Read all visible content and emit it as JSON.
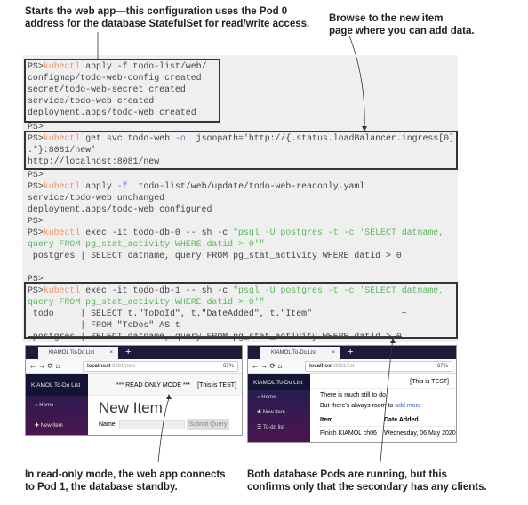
{
  "annotations": {
    "top_left": [
      "Starts the web app—this configuration uses the Pod 0",
      "address for the database StatefulSet for read/write access."
    ],
    "top_right": [
      "Browse to the new item",
      "page where you can add data."
    ],
    "bottom_left": [
      "In read-only mode, the web app connects",
      "to Pod 1, the database standby."
    ],
    "bottom_right": [
      "Both database Pods are running, but this",
      "confirms only that the secondary has any clients."
    ]
  },
  "terminal": {
    "prompt": "PS>",
    "cmd": "kubectl",
    "l1": " apply -f todo-list/web/",
    "l2": "configmap/todo-web-config created",
    "l3": "secret/todo-web-secret created",
    "l4": "service/todo-web created",
    "l5": "deployment.apps/todo-web created",
    "l7a": " get svc todo-web ",
    "l7b": "-o",
    " l7c": " jsonpath='http://{.status.loadBalancer.ingress[0]",
    "l8": ".*}:8081/new'",
    "l9": "http://localhost:8081/new",
    "l11a": " apply ",
    "l11b": "-f",
    " l11c": " todo-list/web/update/todo-web-readonly.yaml",
    "l12": "service/todo-web unchanged",
    "l13": "deployment.apps/todo-web configured",
    "l15a": " exec -it todo-db-0 -- sh -c ",
    "l15b": "\"psql -U postgres -t -c 'SELECT datname,",
    "l16": "query FROM pg_stat_activity WHERE datid > 0'\"",
    "l17": " postgres | SELECT datname, query FROM pg_stat_activity WHERE datid > 0",
    "l20a": " exec -it todo-db-1 -- sh -c ",
    "l22": " todo     | SELECT t.\"ToDoId\", t.\"DateAdded\", t.\"Item\"                 +",
    "l23": "          | FROM \"ToDos\" AS t",
    "l24": " postgres | SELECT datname, query FROM pg_stat_activity WHERE datid > 0"
  },
  "browser_left": {
    "tab": "KIAMOL To-Do List",
    "url_host": "localhost",
    "url_path": ":8081/new",
    "zoom": "67%",
    "brand": "KIAMOL To-Do List",
    "banner": "*** READ ONLY MODE ***",
    "env": "[This is TEST]",
    "nav": [
      "Home",
      "New item"
    ],
    "heading": "New Item",
    "name_label": "Name:",
    "submit": "Submit Query"
  },
  "browser_right": {
    "tab": "KIAMOL To-Do List",
    "url_host": "localhost",
    "url_path": ":8081/list",
    "zoom": "67%",
    "brand": "KIAMOL To-Do List",
    "env": "[This is TEST]",
    "nav": [
      "Home",
      "New item",
      "To-do list"
    ],
    "msg1": "There is much still to do.",
    "msg2": "But there's always room to ",
    "link": "add more",
    "cols": [
      "Item",
      "Date Added"
    ],
    "row": [
      "Finish KIAMOL ch06",
      "Wednesday, 06 May 2020"
    ]
  }
}
